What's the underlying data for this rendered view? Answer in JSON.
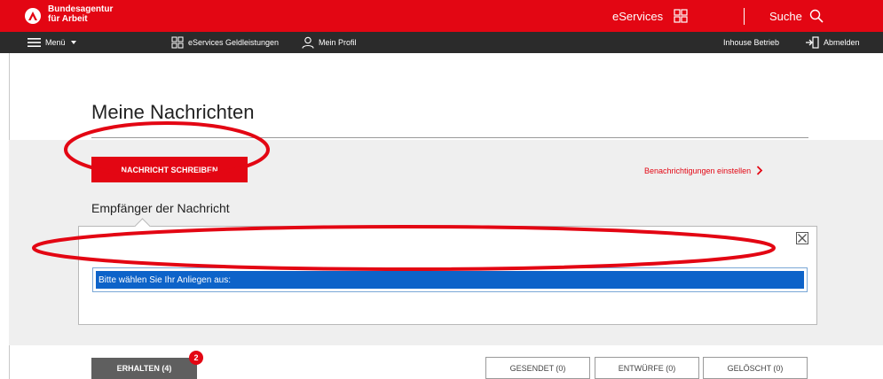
{
  "header": {
    "brand_line1": "Bundesagentur",
    "brand_line2": "für Arbeit",
    "eservices_label": "eServices",
    "search_label": "Suche",
    "brand_color": "#e30613"
  },
  "subnav": {
    "menu_label": "Menü",
    "eservices_money_label": "eServices Geldleistungen",
    "profile_label": "Mein Profil",
    "inhouse_label": "Inhouse Betrieb",
    "logout_label": "Abmelden"
  },
  "page": {
    "title": "Meine Nachrichten",
    "write_button": "NACHRICHT SCHREIBEN",
    "notification_link": "Benachrichtigungen einstellen",
    "recipient_label": "Empfänger der Nachricht",
    "select_value": "Bitte wählen Sie Ihr Anliegen aus:"
  },
  "tabs": {
    "received": "ERHALTEN (4)",
    "received_badge": "2",
    "sent": "GESENDET (0)",
    "drafts": "ENTWÜRFE (0)",
    "deleted": "GELÖSCHT (0)"
  },
  "icons": {
    "logo": "ba-logo-icon",
    "grid": "grid-icon",
    "search": "search-icon",
    "menu": "hamburger-icon",
    "profile": "profile-icon",
    "logout": "logout-icon",
    "close": "close-box-icon",
    "chevron": "chevron-right-icon"
  }
}
